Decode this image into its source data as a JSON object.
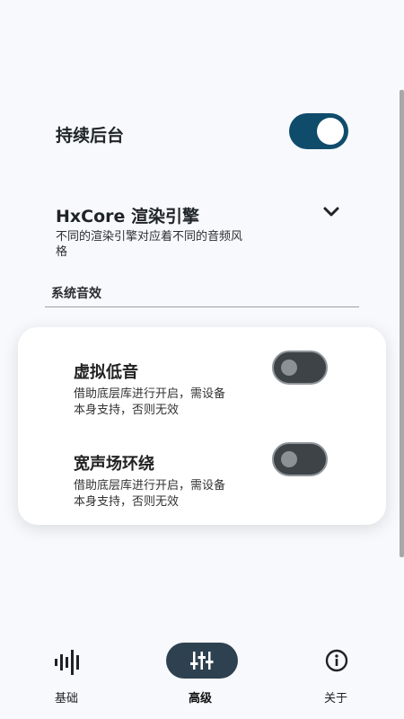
{
  "settings": {
    "keep_background": {
      "label": "持续后台",
      "enabled": true
    },
    "engine": {
      "title": "HxCore 渲染引擎",
      "description_line1": "不同的渲染引擎对应着不同的音频风",
      "description_line2": "格"
    },
    "system_effects_label": "系统音效"
  },
  "effects": [
    {
      "title": "虚拟低音",
      "desc_line1": "借助底层库进行开启，需设备",
      "desc_line2": "本身支持，否则无效",
      "enabled": false
    },
    {
      "title": "宽声场环绕",
      "desc_line1": "借助底层库进行开启，需设备",
      "desc_line2": "本身支持，否则无效",
      "enabled": false
    }
  ],
  "nav": {
    "items": [
      {
        "label": "基础",
        "icon": "waveform-icon"
      },
      {
        "label": "高级",
        "icon": "equalizer-sliders-icon",
        "active": true
      },
      {
        "label": "关于",
        "icon": "info-icon"
      }
    ]
  },
  "colors": {
    "accent": "#0f4c6b",
    "active_pill": "#2e4150",
    "toggle_off": "#3e4347"
  }
}
